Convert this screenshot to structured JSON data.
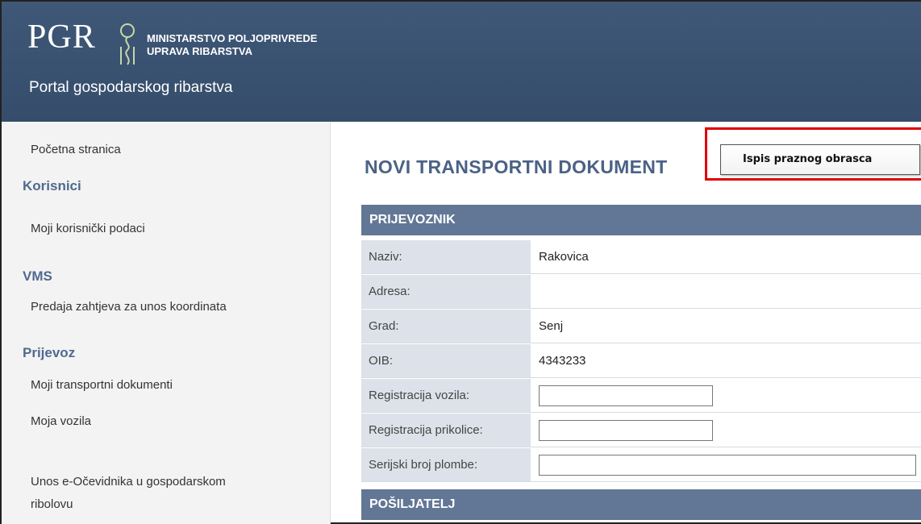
{
  "header": {
    "logo_text": "PGR",
    "ministry_line1": "MINISTARSTVO POLJOPRIVREDE",
    "ministry_line2": "UPRAVA RIBARSTVA",
    "portal_title": "Portal gospodarskog ribarstva"
  },
  "sidebar": {
    "home": "Početna stranica",
    "section_users": "Korisnici",
    "my_user_data": "Moji korisnički podaci",
    "section_vms": "VMS",
    "coord_request": "Predaja zahtjeva za unos koordinata",
    "section_transport": "Prijevoz",
    "my_transport_docs": "Moji transportni dokumenti",
    "my_vehicles": "Moja vozila",
    "logbook_line1": "Unos e-Očevidnika u gospodarskom",
    "logbook_line2": "ribolovu"
  },
  "main": {
    "title": "NOVI TRANSPORTNI DOKUMENT",
    "print_button": "Ispis praznog obrasca",
    "carrier_section": "PRIJEVOZNIK",
    "fields": [
      {
        "label": "Naziv:",
        "value": "Rakovica"
      },
      {
        "label": "Adresa:",
        "value": ""
      },
      {
        "label": "Grad:",
        "value": "Senj"
      },
      {
        "label": "OIB:",
        "value": "4343233"
      }
    ],
    "inputs": [
      {
        "label": "Registracija vozila:",
        "value": ""
      },
      {
        "label": "Registracija prikolice:",
        "value": ""
      },
      {
        "label": "Serijski broj plombe:",
        "value": ""
      }
    ],
    "sender_section": "POŠILJATELJ"
  },
  "colors": {
    "header_bg": "#3f5877",
    "section_bg": "#627795",
    "label_bg": "#dde2ea",
    "highlight": "#e00000"
  }
}
